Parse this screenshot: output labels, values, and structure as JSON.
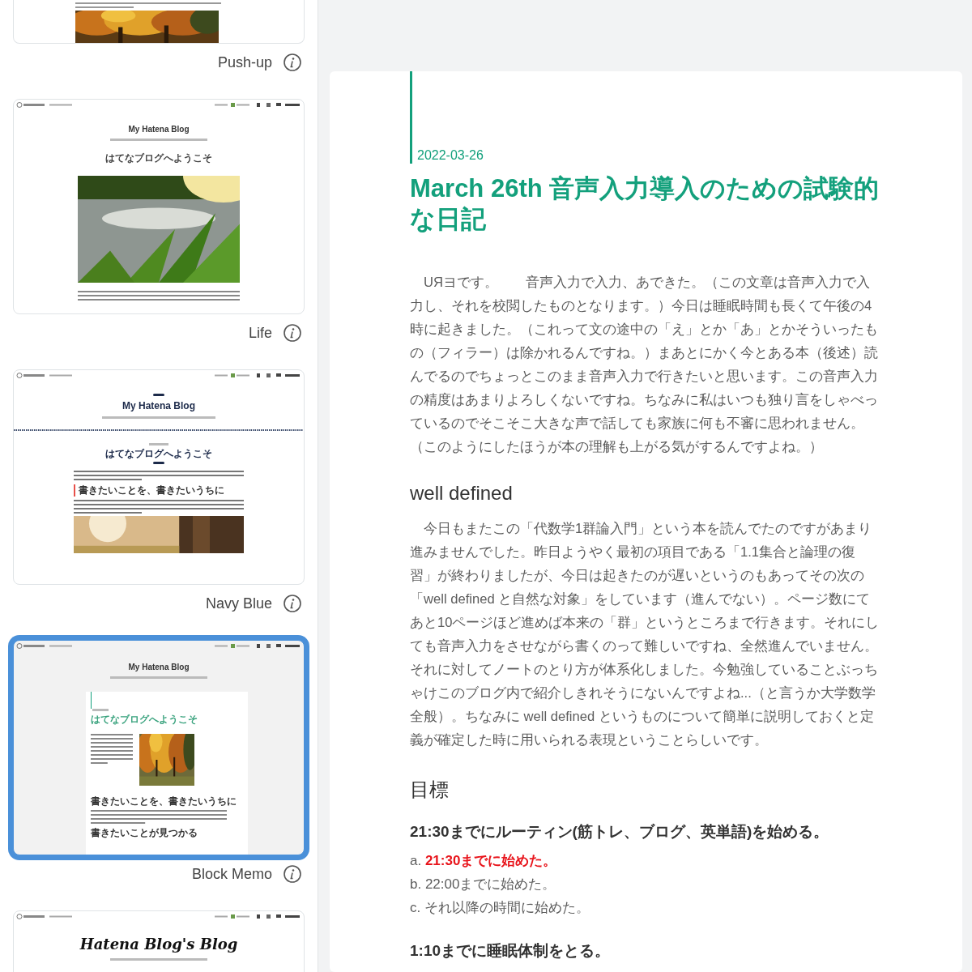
{
  "sidebar": {
    "themes": [
      {
        "name": "Push-up",
        "selected": false,
        "preview": {
          "kind": "pushup"
        }
      },
      {
        "name": "Life",
        "selected": false,
        "preview": {
          "kind": "life",
          "blog_title": "My Hatena Blog",
          "post_title": "はてなブログへようこそ"
        }
      },
      {
        "name": "Navy Blue",
        "selected": false,
        "preview": {
          "kind": "navy",
          "blog_title": "My Hatena Blog",
          "post_title": "はてなブログへようこそ",
          "headings": [
            "書きたいことを、書きたいうちに"
          ]
        }
      },
      {
        "name": "Block Memo",
        "selected": true,
        "preview": {
          "kind": "blockmemo",
          "blog_title": "My Hatena Blog",
          "post_title": "はてなブログへようこそ",
          "headings": [
            "書きたいことを、書きたいうちに",
            "書きたいことが見つかる"
          ]
        }
      },
      {
        "selected": false,
        "preview": {
          "kind": "script",
          "blog_title": "Hatena Blog's Blog"
        }
      }
    ]
  },
  "article": {
    "date": "2022-03-26",
    "title": "March 26th 音声入力導入のための試験的な日記",
    "blocks": [
      {
        "kind": "paragraph",
        "text": "　UЯヨです。　　音声入力で入力、あできた。（この文章は音声入力で入力し、それを校閲したものとなります。）今日は睡眠時間も長くて午後の4時に起きました。（これって文の途中の「え」とか「あ」とかそういったもの（フィラー）は除かれるんですね。）まあとにかく今とある本（後述）読んでるのでちょっとこのまま音声入力で行きたいと思います。この音声入力の精度はあまりよろしくないですね。ちなみに私はいつも独り言をしゃべっているのでそこそこ大きな声で話しても家族に何も不審に思われません。（このようにしたほうが本の理解も上がる気がするんですよね。）"
      },
      {
        "kind": "heading",
        "text": "well defined"
      },
      {
        "kind": "paragraph",
        "text": "　今日もまたこの「代数学1群論入門」という本を読んでたのですがあまり進みませんでした。昨日ようやく最初の項目である「1.1集合と論理の復習」が終わりましたが、今日は起きたのが遅いというのもあってその次の「well defined と自然な対象」をしています（進んでない）。ページ数にてあと10ページほど進めば本来の「群」というところまで行きます。それにしても音声入力をさせながら書くのって難しいですね、全然進んでいません。それに対してノートのとり方が体系化しました。今勉強していることぶっちゃけこのブログ内で紹介しきれそうにないんですよね...（と言うか大学数学全般）。ちなみに well defined というものについて簡単に説明しておくと定義が確定した時に用いられる表現ということらしいです。"
      },
      {
        "kind": "heading",
        "text": "目標"
      },
      {
        "kind": "subheading",
        "text": "21:30までにルーティン(筋トレ、ブログ、英単語)を始める。"
      },
      {
        "kind": "options",
        "items": [
          {
            "marker": "a.",
            "text": "21:30までに始めた。",
            "highlight": true
          },
          {
            "marker": "b.",
            "text": "22:00までに始めた。",
            "highlight": false
          },
          {
            "marker": "c.",
            "text": "それ以降の時間に始めた。",
            "highlight": false
          }
        ]
      },
      {
        "kind": "subheading",
        "text": "1:10までに睡眠体制をとる。"
      }
    ]
  }
}
